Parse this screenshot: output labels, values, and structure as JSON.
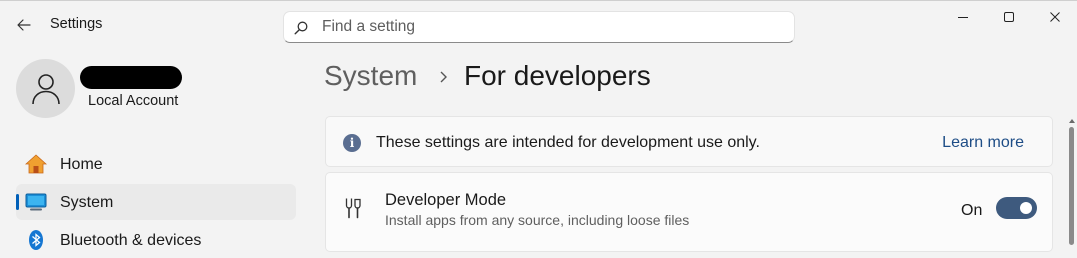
{
  "window": {
    "title": "Settings",
    "controls": {
      "minimize": "minimize-icon",
      "maximize": "maximize-icon",
      "close": "close-icon"
    }
  },
  "search": {
    "placeholder": "Find a setting",
    "value": ""
  },
  "account": {
    "name": "",
    "type": "Local Account"
  },
  "sidebar": {
    "items": [
      {
        "label": "Home",
        "icon": "home-icon",
        "selected": false
      },
      {
        "label": "System",
        "icon": "system-display-icon",
        "selected": true
      },
      {
        "label": "Bluetooth & devices",
        "icon": "bluetooth-icon",
        "selected": false
      }
    ]
  },
  "breadcrumb": {
    "root": "System",
    "current": "For developers"
  },
  "info_bar": {
    "text": "These settings are intended for development use only.",
    "link": "Learn more"
  },
  "developer_mode": {
    "title": "Developer Mode",
    "description": "Install apps from any source, including loose files",
    "state": "On",
    "enabled": true
  },
  "colors": {
    "accent": "#005fb8",
    "toggle_on": "#3e5a7e",
    "link": "#1e4d86"
  }
}
